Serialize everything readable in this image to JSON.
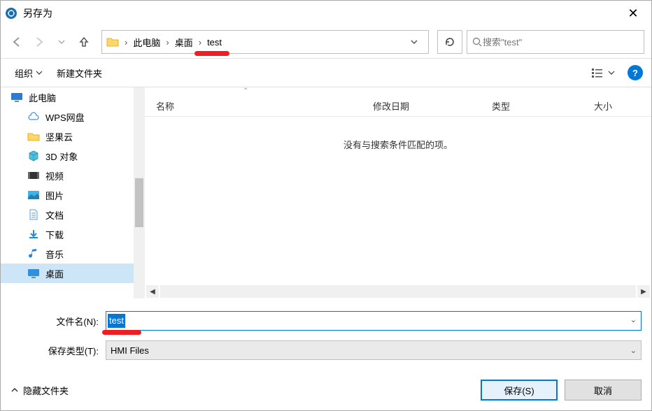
{
  "title": "另存为",
  "breadcrumbs": {
    "root_sep": "›",
    "pc": "此电脑",
    "desktop": "桌面",
    "folder": "test"
  },
  "search_placeholder": "搜索\"test\"",
  "toolbar": {
    "organize": "组织",
    "new_folder": "新建文件夹"
  },
  "sidebar": {
    "this_pc": "此电脑",
    "wps": "WPS网盘",
    "jianguo": "坚果云",
    "objects3d": "3D 对象",
    "videos": "视频",
    "pictures": "图片",
    "documents": "文档",
    "downloads": "下载",
    "music": "音乐",
    "desktop": "桌面"
  },
  "columns": {
    "name": "名称",
    "date": "修改日期",
    "type": "类型",
    "size": "大小"
  },
  "empty_message": "没有与搜索条件匹配的项。",
  "form": {
    "filename_label": "文件名(N):",
    "filetype_label": "保存类型(T):",
    "filename_value": "test",
    "filetype_value": "HMI Files"
  },
  "footer": {
    "hide_folders": "隐藏文件夹",
    "save": "保存(S)",
    "cancel": "取消"
  }
}
